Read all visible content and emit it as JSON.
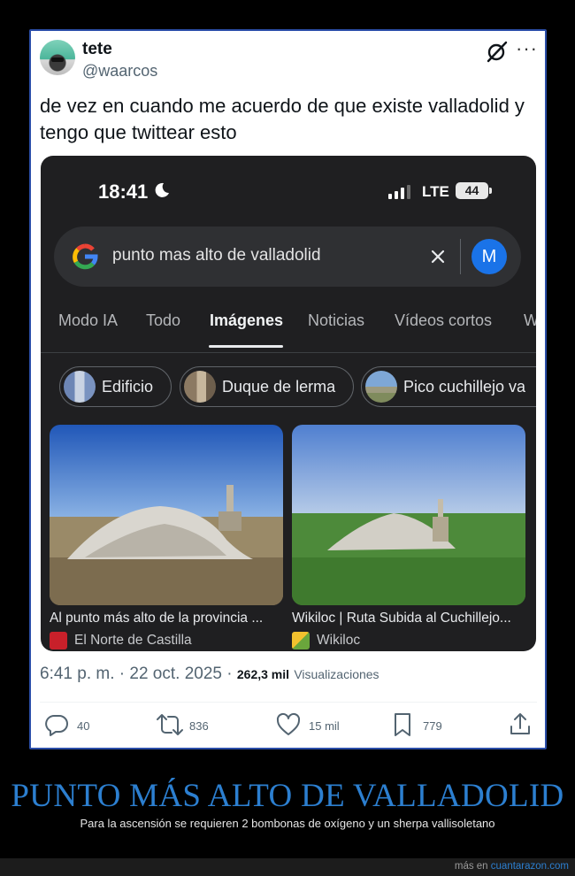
{
  "tweet": {
    "display_name": "tete",
    "handle": "@waarcos",
    "text": "de vez en cuando me acuerdo de que existe valladolid y tengo que twittear esto",
    "time": "6:41 p. m.",
    "separator": "·",
    "date": "22 oct. 2025",
    "views_count": "262,3 mil",
    "views_label": "Visualizaciones",
    "actions": {
      "reply_count": "40",
      "retweet_count": "836",
      "like_count": "15 mil",
      "bookmark_count": "779"
    },
    "icons": [
      "grok-icon",
      "more-icon",
      "reply-icon",
      "retweet-icon",
      "like-icon",
      "bookmark-icon",
      "share-icon"
    ]
  },
  "phone": {
    "status_time": "18:41",
    "network": "LTE",
    "battery": "44",
    "search_query": "punto mas alto de valladolid",
    "account_initial": "M",
    "tabs": [
      "Modo IA",
      "Todo",
      "Imágenes",
      "Noticias",
      "Vídeos cortos",
      "W"
    ],
    "active_tab": "Imágenes",
    "chips": [
      "Edificio",
      "Duque de lerma",
      "Pico cuchillejo va"
    ],
    "results": [
      {
        "title": "Al punto más alto de la provincia ...",
        "source": "El Norte de Castilla"
      },
      {
        "title": "Wikiloc | Ruta Subida al Cuchillejo...",
        "source": "Wikiloc"
      }
    ]
  },
  "caption": {
    "headline": "PUNTO MÁS ALTO DE VALLADOLID",
    "subtitle": "Para la ascensión se requieren 2 bombonas de oxígeno y un sherpa vallisoletano"
  },
  "footer": {
    "prefix": "más en",
    "link": "cuantarazon.com"
  },
  "colors": {
    "headline_blue": "#2c7fd0",
    "card_border": "#2b4ea8",
    "phone_bg": "#1f1f21",
    "account_blue": "#1a73e8"
  }
}
